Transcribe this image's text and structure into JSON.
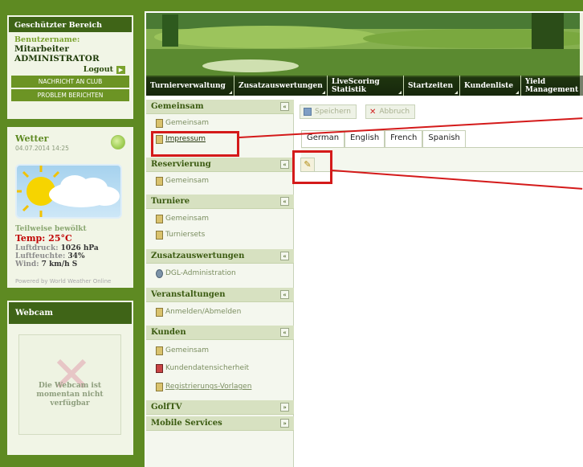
{
  "login_panel": {
    "title": "Geschützter Bereich",
    "username_label": "Benutzername:",
    "username_line1": "Mitarbeiter",
    "username_line2": "ADMINISTRATOR",
    "logout_label": "Logout",
    "btn_message": "NACHRICHT AN CLUB",
    "btn_report": "PROBLEM BERICHTEN"
  },
  "weather": {
    "title": "Wetter",
    "date": "04.07.2014 14:25",
    "description": "Teilweise bewölkt",
    "temp_label": "Temp:",
    "temp_value": "25°C",
    "pressure_label": "Luftdruck:",
    "pressure_value": "1026 hPa",
    "humidity_label": "Luftfeuchte:",
    "humidity_value": "34%",
    "wind_label": "Wind:",
    "wind_value": "7 km/h S",
    "powered_by": "Powered by World Weather Online"
  },
  "webcam": {
    "title": "Webcam",
    "message": "Die Webcam ist momentan nicht verfügbar"
  },
  "nav": {
    "items": [
      {
        "label": "Turnierverwaltung"
      },
      {
        "label": "Zusatzauswertungen"
      },
      {
        "label": "LiveScoring Statistik"
      },
      {
        "label": "Startzeiten"
      },
      {
        "label": "Kundenliste"
      },
      {
        "label": "Yield Management"
      }
    ]
  },
  "sidebar": {
    "sections": [
      {
        "title": "Gemeinsam",
        "toggle": "«",
        "items": [
          "Gemeinsam",
          "Impressum"
        ]
      },
      {
        "title": "Reservierung",
        "toggle": "«",
        "items": [
          "Gemeinsam"
        ]
      },
      {
        "title": "Turniere",
        "toggle": "«",
        "items": [
          "Gemeinsam",
          "Turniersets"
        ]
      },
      {
        "title": "Zusatzauswertungen",
        "toggle": "«",
        "items": [
          "DGL-Administration"
        ]
      },
      {
        "title": "Veranstaltungen",
        "toggle": "«",
        "items": [
          "Anmelden/Abmelden"
        ]
      },
      {
        "title": "Kunden",
        "toggle": "«",
        "items": [
          "Gemeinsam",
          "Kundendatensicherheit",
          "Registrierungs-Vorlagen"
        ]
      },
      {
        "title": "GolfTV",
        "toggle": "»",
        "items": []
      },
      {
        "title": "Mobile Services",
        "toggle": "»",
        "items": []
      }
    ]
  },
  "toolbar": {
    "save_label": "Speichern",
    "cancel_label": "Abbruch"
  },
  "tabs": [
    "German",
    "English",
    "French",
    "Spanish"
  ],
  "colors": {
    "brand_dark": "#3f6417",
    "brand": "#5e8a22",
    "highlight": "#d41a1a",
    "temp": "#c00000"
  },
  "icons": {
    "edit": "pencil-icon",
    "save": "disk-icon",
    "cancel": "x-icon"
  }
}
